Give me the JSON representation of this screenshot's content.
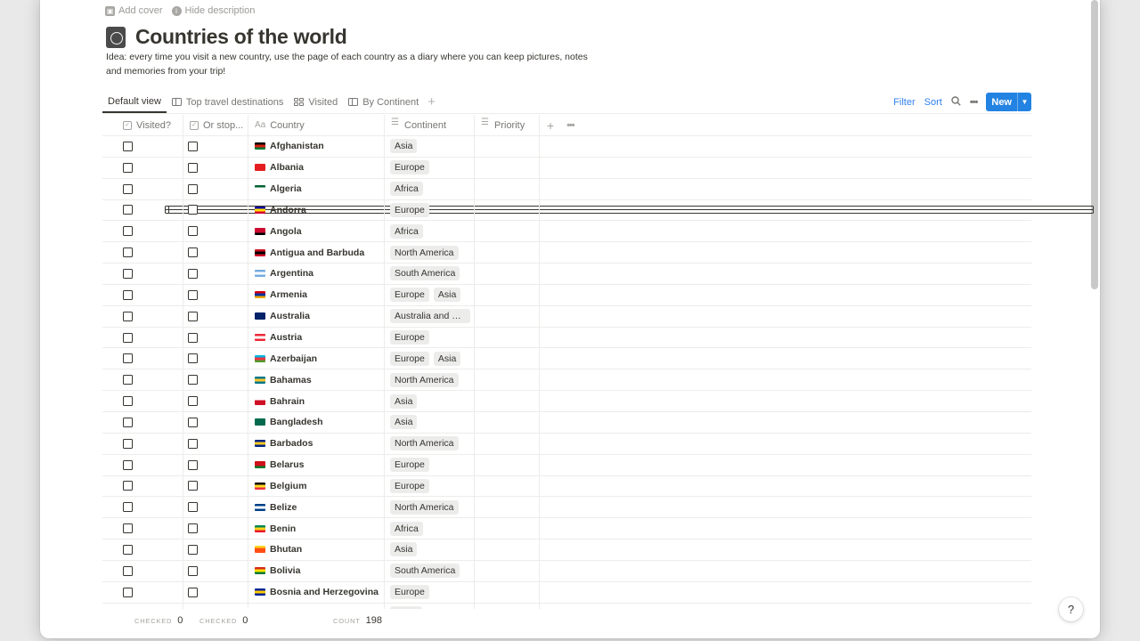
{
  "page_actions": {
    "add_cover": "Add cover",
    "hide_description": "Hide description"
  },
  "page": {
    "icon": "passport-icon",
    "title": "Countries of the world",
    "description": "Idea: every time you visit a new country, use the page of each country as a diary where you can keep pictures, notes and memories from your trip!"
  },
  "views": [
    {
      "label": "Default view",
      "icon": "table-icon",
      "active": true
    },
    {
      "label": "Top travel destinations",
      "icon": "board-icon",
      "active": false
    },
    {
      "label": "Visited",
      "icon": "gallery-icon",
      "active": false
    },
    {
      "label": "By Continent",
      "icon": "board-icon",
      "active": false
    }
  ],
  "toolbar": {
    "filter": "Filter",
    "sort": "Sort",
    "new_label": "New"
  },
  "columns": {
    "visited": "Visited?",
    "or_stop": "Or stop...",
    "country_prefix": "Aa",
    "country": "Country",
    "continent": "Continent",
    "priority": "Priority"
  },
  "rows": [
    {
      "country": "Afghanistan",
      "continent": [
        "Asia"
      ],
      "flag": [
        "#000000",
        "#d32011",
        "#007a36"
      ]
    },
    {
      "country": "Albania",
      "continent": [
        "Europe"
      ],
      "flag": [
        "#e41e20",
        "#e41e20",
        "#e41e20"
      ]
    },
    {
      "country": "Algeria",
      "continent": [
        "Africa"
      ],
      "flag": [
        "#006233",
        "#ffffff",
        "#ffffff"
      ]
    },
    {
      "country": "Andorra",
      "continent": [
        "Europe"
      ],
      "flag": [
        "#10069f",
        "#fedf00",
        "#d50032"
      ]
    },
    {
      "country": "Angola",
      "continent": [
        "Africa"
      ],
      "flag": [
        "#cc092f",
        "#cc092f",
        "#000000"
      ]
    },
    {
      "country": "Antigua and Barbuda",
      "continent": [
        "North America"
      ],
      "flag": [
        "#ce1126",
        "#000000",
        "#ce1126"
      ]
    },
    {
      "country": "Argentina",
      "continent": [
        "South America"
      ],
      "flag": [
        "#74acdf",
        "#ffffff",
        "#74acdf"
      ]
    },
    {
      "country": "Armenia",
      "continent": [
        "Europe",
        "Asia"
      ],
      "flag": [
        "#d90012",
        "#0033a0",
        "#f2a800"
      ]
    },
    {
      "country": "Australia",
      "continent": [
        "Australia and Oceania"
      ],
      "flag": [
        "#012169",
        "#012169",
        "#012169"
      ]
    },
    {
      "country": "Austria",
      "continent": [
        "Europe"
      ],
      "flag": [
        "#ed2939",
        "#ffffff",
        "#ed2939"
      ]
    },
    {
      "country": "Azerbaijan",
      "continent": [
        "Europe",
        "Asia"
      ],
      "flag": [
        "#00b5e2",
        "#ef3340",
        "#509e2f"
      ]
    },
    {
      "country": "Bahamas",
      "continent": [
        "North America"
      ],
      "flag": [
        "#00778b",
        "#ffc72c",
        "#00778b"
      ]
    },
    {
      "country": "Bahrain",
      "continent": [
        "Asia"
      ],
      "flag": [
        "#ffffff",
        "#ce1126",
        "#ce1126"
      ]
    },
    {
      "country": "Bangladesh",
      "continent": [
        "Asia"
      ],
      "flag": [
        "#006a4e",
        "#006a4e",
        "#006a4e"
      ]
    },
    {
      "country": "Barbados",
      "continent": [
        "North America"
      ],
      "flag": [
        "#00267f",
        "#ffc726",
        "#00267f"
      ]
    },
    {
      "country": "Belarus",
      "continent": [
        "Europe"
      ],
      "flag": [
        "#cf101a",
        "#cf101a",
        "#007d2c"
      ]
    },
    {
      "country": "Belgium",
      "continent": [
        "Europe"
      ],
      "flag": [
        "#000000",
        "#fdda24",
        "#ef3340"
      ]
    },
    {
      "country": "Belize",
      "continent": [
        "North America"
      ],
      "flag": [
        "#003f87",
        "#ffffff",
        "#003f87"
      ]
    },
    {
      "country": "Benin",
      "continent": [
        "Africa"
      ],
      "flag": [
        "#008751",
        "#fcd116",
        "#e8112d"
      ]
    },
    {
      "country": "Bhutan",
      "continent": [
        "Asia"
      ],
      "flag": [
        "#ffd520",
        "#ff4e12",
        "#ff4e12"
      ]
    },
    {
      "country": "Bolivia",
      "continent": [
        "South America"
      ],
      "flag": [
        "#d52b1e",
        "#f9e300",
        "#007934"
      ]
    },
    {
      "country": "Bosnia and Herzegovina",
      "continent": [
        "Europe"
      ],
      "flag": [
        "#002395",
        "#fecb00",
        "#002395"
      ]
    }
  ],
  "footer": {
    "visited_label": "CHECKED",
    "visited_value": "0",
    "or_stop_label": "CHECKED",
    "or_stop_value": "0",
    "count_label": "COUNT",
    "count_value": "198"
  },
  "help": "?"
}
